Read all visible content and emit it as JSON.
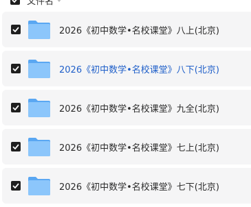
{
  "header": {
    "label": "文件名",
    "checked": true,
    "sort_icon": "caret-down-icon"
  },
  "files": [
    {
      "name": "2026《初中数学•名校课堂》八上(北京)",
      "checked": true,
      "icon": "folder-icon",
      "highlighted": false
    },
    {
      "name": "2026《初中数学•名校课堂》八下(北京)",
      "checked": true,
      "icon": "folder-icon",
      "highlighted": true
    },
    {
      "name": "2026《初中数学•名校课堂》九全(北京)",
      "checked": true,
      "icon": "folder-icon",
      "highlighted": false
    },
    {
      "name": "2026《初中数学•名校课堂》七上(北京)",
      "checked": true,
      "icon": "folder-icon",
      "highlighted": false
    },
    {
      "name": "2026《初中数学•名校课堂》七下(北京)",
      "checked": true,
      "icon": "folder-icon",
      "highlighted": false
    }
  ],
  "colors": {
    "checkbox": "#1f1f1f",
    "row_background": "#f5f5f6",
    "highlight_text": "#1f5fc9",
    "folder": "#6fb3f5"
  }
}
